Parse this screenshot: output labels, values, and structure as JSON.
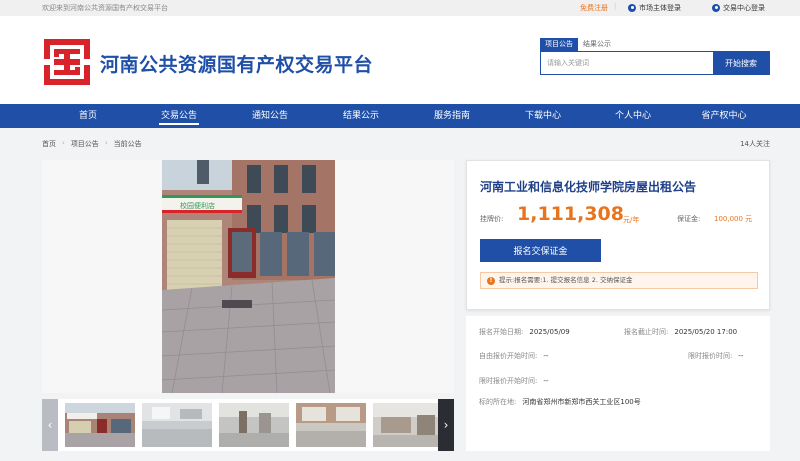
{
  "topbar": {
    "welcome": "欢迎来到河南公共资源国有产权交易平台",
    "register": "免费注册",
    "login_market": "市场主体登录",
    "login_center": "交易中心登录"
  },
  "header": {
    "title": "河南公共资源国有产权交易平台",
    "brand_color": "#1f4fa6",
    "logo_color": "#d9232a"
  },
  "search": {
    "tabs": [
      "项目公告",
      "结果公示"
    ],
    "active_tab": 0,
    "placeholder": "请输入关键词",
    "button": "开始搜索"
  },
  "nav": {
    "items": [
      "首页",
      "交易公告",
      "通知公告",
      "结果公示",
      "服务指南",
      "下载中心",
      "个人中心",
      "省产权中心"
    ],
    "active": 1
  },
  "breadcrumb": {
    "items": [
      "首页",
      "项目公告",
      "当前公告"
    ],
    "followers": "14人关注"
  },
  "notice": {
    "title": "河南工业和信息化技师学院房屋出租公告",
    "price_label": "挂牌价:",
    "price": "1,111,308",
    "price_unit": "元/年",
    "deposit_label": "保证金:",
    "deposit": "100,000 元",
    "deposit_button": "报名交保证金",
    "tip": "提示:报名需要:1. 提交报名信息 2. 交纳保证金",
    "accent_color": "#e8741d"
  },
  "details": {
    "signup_start_label": "报名开始日期:",
    "signup_start": "2025/05/09",
    "signup_end_label": "报名截止时间:",
    "signup_end": "2025/05/20 17:00",
    "free_bid_start_label": "自由报价开始时间:",
    "free_bid_start": "--",
    "limit_time_label": "限时报价时间:",
    "limit_time": "--",
    "limit_bid_start_label": "限时报价开始时间:",
    "limit_bid_start": "--",
    "location_label": "标的所在地:",
    "location": "河南省郑州市新郑市西关工业区100号"
  },
  "gallery": {
    "sign_text": "校园便利店",
    "thumb_count": 5
  }
}
